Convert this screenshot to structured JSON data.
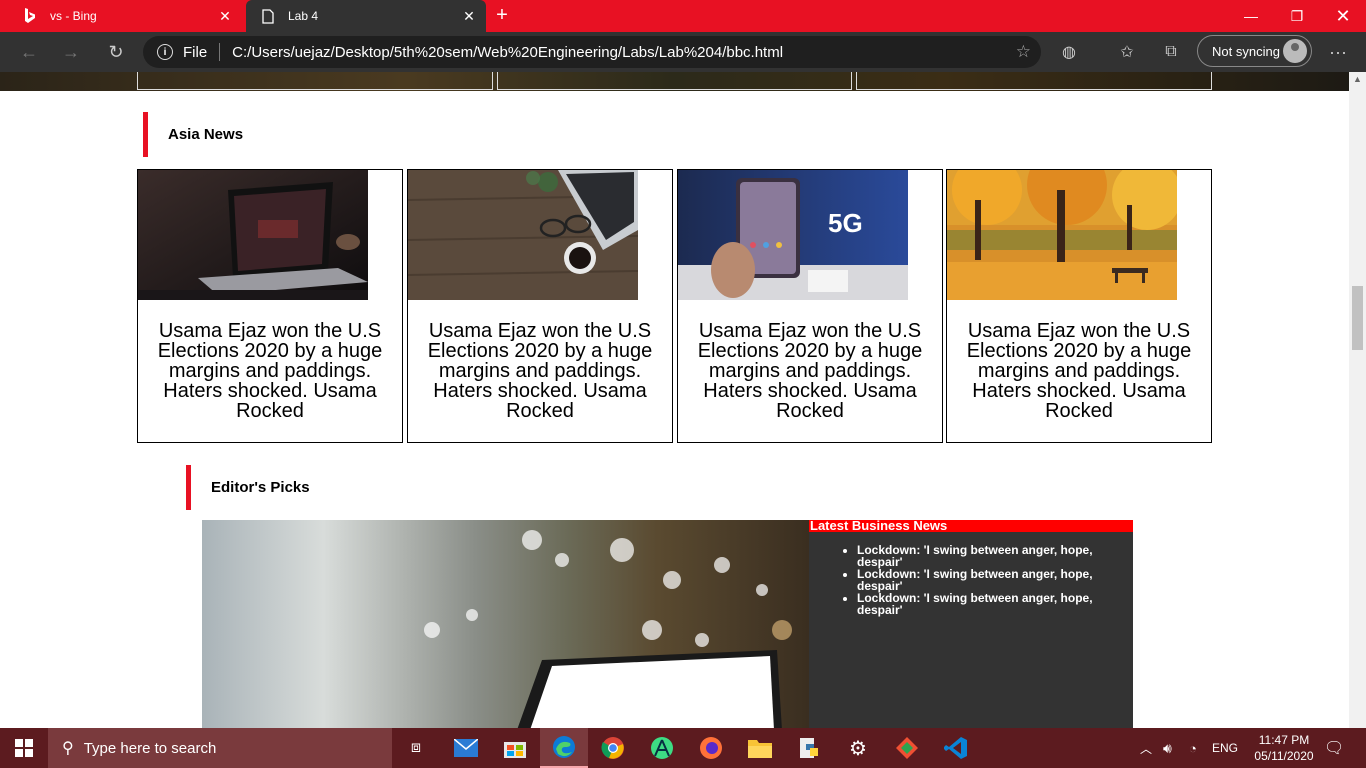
{
  "browser": {
    "tabs": [
      {
        "title": "vs - Bing",
        "active": false,
        "icon": "bing-icon"
      },
      {
        "title": "Lab 4",
        "active": true,
        "icon": "page-icon"
      }
    ],
    "new_tab": "+",
    "url_scheme": "File",
    "url": "C:/Users/uejaz/Desktop/5th%20sem/Web%20Engineering/Labs/Lab%204/bbc.html",
    "sync_label": "Not syncing",
    "more": "···"
  },
  "page": {
    "asia_news": {
      "title": "Asia News",
      "cards": [
        {
          "caption": "Usama Ejaz won the U.S Elections 2020 by a huge margins and paddings. Haters shocked. Usama Rocked",
          "image": "laptop-dark-desk"
        },
        {
          "caption": "Usama Ejaz won the U.S Elections 2020 by a huge margins and paddings. Haters shocked. Usama Rocked",
          "image": "wooden-desk-coffee"
        },
        {
          "caption": "Usama Ejaz won the U.S Elections 2020 by a huge margins and paddings. Haters shocked. Usama Rocked",
          "image": "foldable-phone-5g"
        },
        {
          "caption": "Usama Ejaz won the U.S Elections 2020 by a huge margins and paddings. Haters shocked. Usama Rocked",
          "image": "autumn-park-bench"
        }
      ]
    },
    "editors_picks": {
      "title": "Editor's Picks",
      "latest_header": "Latest Business News",
      "items": [
        "Lockdown: 'I swing between anger, hope, despair'",
        "Lockdown: 'I swing between anger, hope, despair'",
        "Lockdown: 'I swing between anger, hope, despair'"
      ]
    }
  },
  "taskbar": {
    "search_placeholder": "Type here to search",
    "language": "ENG",
    "time": "11:47 PM",
    "date": "05/11/2020"
  },
  "colors": {
    "accent": "#e81123",
    "toolbar": "#323232",
    "latest_bg": "#333333",
    "latest_header": "#ff0000",
    "taskbar": "#5c1b1f"
  }
}
